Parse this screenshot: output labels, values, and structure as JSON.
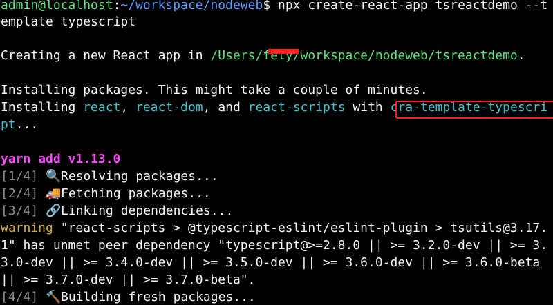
{
  "colors": {
    "background": "#000000",
    "text": "#f2f2f2",
    "prompt_host": "#5fe07a",
    "prompt_path": "#5f9bff",
    "path_highlight": "#3fc3cf",
    "yarn": "#ff4cff",
    "step": "#8f8f8f",
    "warning": "#d4b13a",
    "annotation": "#ff2020"
  },
  "prompt": {
    "user_host": "admin@localhost",
    "colon": ":",
    "path": "~/workspace/nodeweb",
    "symbol": "$ ",
    "command_line1": "npx create-react-app tsreactdemo --t",
    "command_line2": "emplate typescript"
  },
  "creating": {
    "prefix": "Creating a new React app in ",
    "path": "/Users/fely/workspace/nodeweb/tsreactdemo",
    "suffix": "."
  },
  "installing_msg": "Installing packages. This might take a couple of minutes.",
  "installing": {
    "prefix": "Installing ",
    "pkg1": "react",
    "sep1": ", ",
    "pkg2": "react-dom",
    "sep2": ", and ",
    "pkg3": "react-scripts",
    "with": " with ",
    "template_a": "cra-template-typescri",
    "template_b": "pt",
    "suffix": "..."
  },
  "yarn": "yarn add v1.13.0",
  "steps": [
    {
      "num": "[1/4]",
      "icon": "magnifier-icon",
      "glyph": "🔍",
      "text": "Resolving packages..."
    },
    {
      "num": "[2/4]",
      "icon": "truck-icon",
      "glyph": "🚚",
      "text": "Fetching packages..."
    },
    {
      "num": "[3/4]",
      "icon": "link-icon",
      "glyph": "🔗",
      "text": "Linking dependencies..."
    }
  ],
  "warning": {
    "label": "warning",
    "line1": " \"react-scripts > @typescript-eslint/eslint-plugin > tsutils@3.17.",
    "line2": "1\" has unmet peer dependency \"typescript@>=2.8.0 || >= 3.2.0-dev || >= 3.",
    "line3": "3.0-dev || >= 3.4.0-dev || >= 3.5.0-dev || >= 3.6.0-dev || >= 3.6.0-beta",
    "line4": "|| >= 3.7.0-dev || >= 3.7.0-beta\"."
  },
  "step4": {
    "num": "[4/4]",
    "icon": "hammer-icon",
    "glyph": "🔨",
    "text": "Building fresh packages..."
  }
}
